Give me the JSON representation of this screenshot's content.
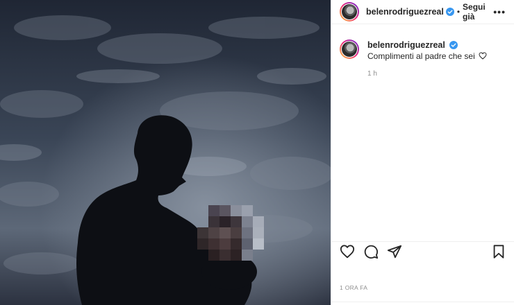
{
  "header": {
    "username": "belenrodriguezreal",
    "separator": "•",
    "follow_label": "Segui già",
    "more_label": "•••"
  },
  "comment": {
    "username": "belenrodriguezreal",
    "text": "Complimenti al padre che sei",
    "time": "1 h"
  },
  "footer": {
    "timestamp": "1 ORA FA"
  },
  "icons": {
    "verified": "verified-badge-icon",
    "like": "heart-icon",
    "comment": "comment-bubble-icon",
    "share": "paper-plane-icon",
    "save": "bookmark-icon",
    "inline_heart": "white-heart-icon"
  },
  "colors": {
    "verified": "#3897f0",
    "text": "#262626",
    "muted": "#8e8e8e"
  }
}
